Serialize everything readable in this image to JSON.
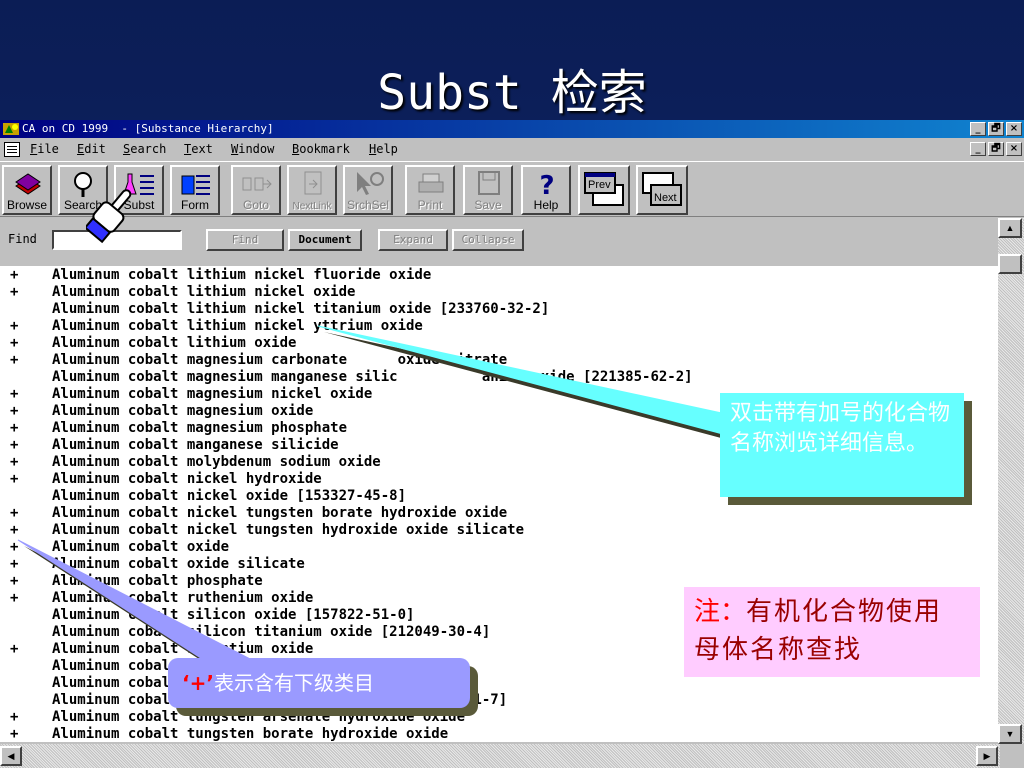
{
  "slide": {
    "title": "Subst 检索"
  },
  "window": {
    "title": "CA on CD 1999  - [Substance Hierarchy]",
    "controls": [
      "_",
      "🗗",
      "×"
    ]
  },
  "menubar": {
    "items": [
      {
        "ul": "F",
        "rest": "ile"
      },
      {
        "ul": "E",
        "rest": "dit"
      },
      {
        "ul": "S",
        "rest": "earch"
      },
      {
        "ul": "T",
        "rest": "ext"
      },
      {
        "ul": "W",
        "rest": "indow"
      },
      {
        "ul": "B",
        "rest": "ookmark"
      },
      {
        "ul": "H",
        "rest": "elp"
      }
    ]
  },
  "toolbar": {
    "browse": "Browse",
    "search": "Search",
    "subst": "Subst",
    "form": "Form",
    "goto": "Goto",
    "nextlink": "NextLink",
    "srchsel": "SrchSel",
    "print": "Print",
    "save": "Save",
    "help": "Help",
    "prev": "Prev",
    "next": "Next"
  },
  "findbar": {
    "label": "Find",
    "value": "",
    "find_btn": "Find",
    "document_btn": "Document",
    "expand_btn": "Expand",
    "collapse_btn": "Collapse"
  },
  "rows": [
    {
      "plus": "+",
      "name": "Aluminum cobalt lithium nickel fluoride oxide"
    },
    {
      "plus": "+",
      "name": "Aluminum cobalt lithium nickel oxide"
    },
    {
      "plus": "",
      "name": "Aluminum cobalt lithium nickel titanium oxide [233760-32-2]"
    },
    {
      "plus": "+",
      "name": "Aluminum cobalt lithium nickel yttrium oxide"
    },
    {
      "plus": "+",
      "name": "Aluminum cobalt lithium oxide"
    },
    {
      "plus": "+",
      "name": "Aluminum cobalt magnesium carbonate      oxide nitrate"
    },
    {
      "plus": "",
      "name": "Aluminum cobalt magnesium manganese silic          anium oxide [221385-62-2]"
    },
    {
      "plus": "+",
      "name": "Aluminum cobalt magnesium nickel oxide"
    },
    {
      "plus": "+",
      "name": "Aluminum cobalt magnesium oxide"
    },
    {
      "plus": "+",
      "name": "Aluminum cobalt magnesium phosphate"
    },
    {
      "plus": "+",
      "name": "Aluminum cobalt manganese silicide"
    },
    {
      "plus": "+",
      "name": "Aluminum cobalt molybdenum sodium oxide"
    },
    {
      "plus": "+",
      "name": "Aluminum cobalt nickel hydroxide"
    },
    {
      "plus": "",
      "name": "Aluminum cobalt nickel oxide [153327-45-8]"
    },
    {
      "plus": "+",
      "name": "Aluminum cobalt nickel tungsten borate hydroxide oxide"
    },
    {
      "plus": "+",
      "name": "Aluminum cobalt nickel tungsten hydroxide oxide silicate"
    },
    {
      "plus": "+",
      "name": "Aluminum cobalt oxide"
    },
    {
      "plus": "+",
      "name": "Aluminum cobalt oxide silicate"
    },
    {
      "plus": "+",
      "name": "Aluminum cobalt phosphate"
    },
    {
      "plus": "+",
      "name": "Aluminum cobalt ruthenium oxide"
    },
    {
      "plus": "",
      "name": "Aluminum cobalt silicon oxide [157822-51-0]"
    },
    {
      "plus": "",
      "name": "Aluminum cobalt silicon titanium oxide [212049-30-4]"
    },
    {
      "plus": "+",
      "name": "Aluminum cobalt strontium oxide"
    },
    {
      "plus": "",
      "name": "Aluminum cobalt"
    },
    {
      "plus": "",
      "name": "Aluminum cobalt                                 6]"
    },
    {
      "plus": "",
      "name": "Aluminum cobalt                                5-61-7]"
    },
    {
      "plus": "+",
      "name": "Aluminum cobalt tungsten arsenate hydroxide oxide"
    },
    {
      "plus": "+",
      "name": "Aluminum cobalt tungsten borate hydroxide oxide"
    }
  ],
  "callouts": {
    "double_click": "双击带有加号的化合物名称浏览详细信息。",
    "plus_mark": "‘+’",
    "plus_meaning": "表示含有下级类目",
    "note_label": "注：",
    "note_text": "有机化合物使用母体名称查找"
  },
  "colors": {
    "slide_bg": "#0b1d55",
    "callout_cyan": "#66ffff",
    "callout_purple": "#9a9aff",
    "note_pink": "#ffccff",
    "titlebar_blue": "#000080"
  },
  "icons": {
    "app": "app-icon",
    "browse": "books-icon",
    "search": "magnifier-icon",
    "subst": "flask-list-icon",
    "form": "beaker-list-icon",
    "goto": "goto-icon",
    "nextlink": "nextlink-icon",
    "srchsel": "pointer-magnifier-icon",
    "print": "printer-icon",
    "save": "floppy-icon",
    "help": "question-icon",
    "cursor": "hand-pointer-icon"
  }
}
